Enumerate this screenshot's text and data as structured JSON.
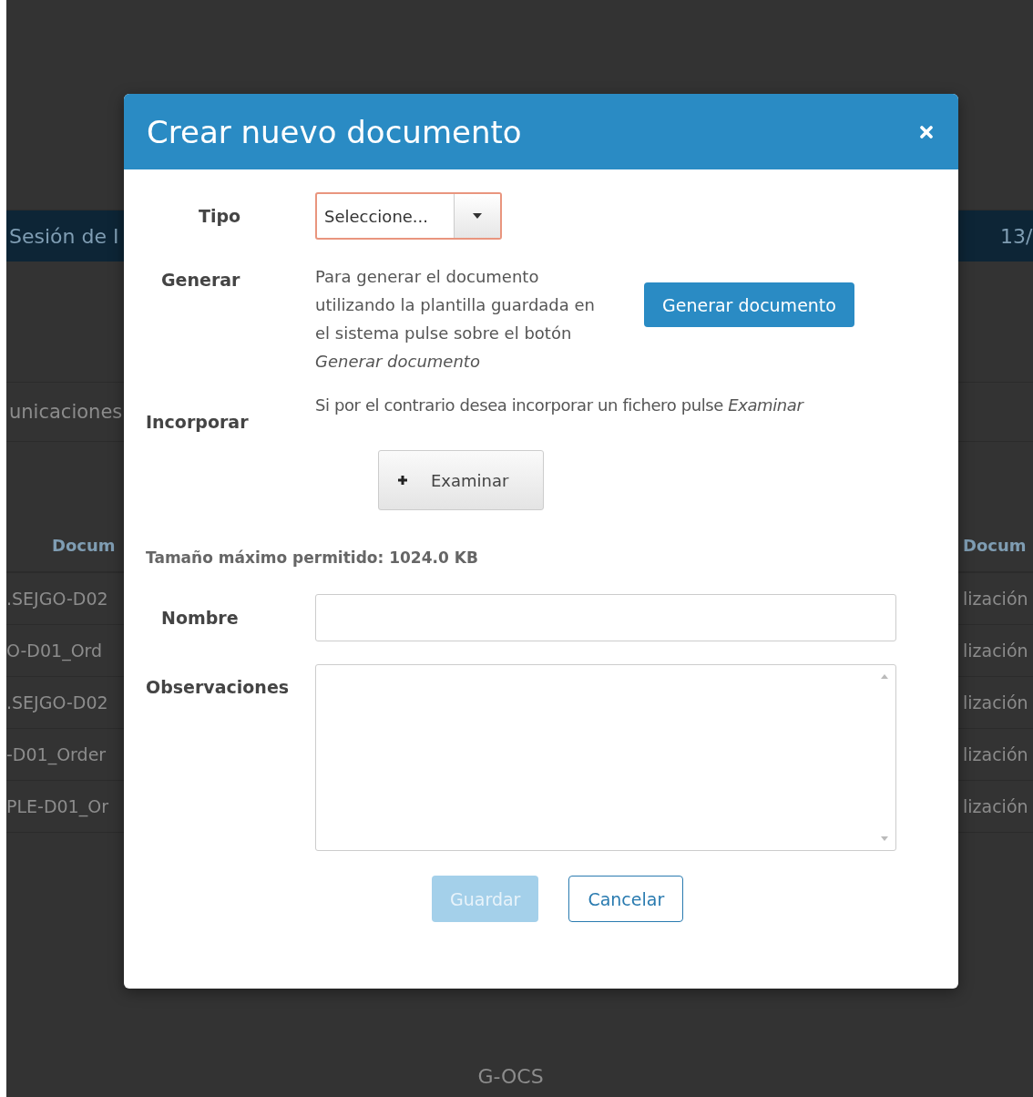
{
  "background": {
    "banner": {
      "left": "Sesión de I",
      "right": "13/"
    },
    "section": "unicaciones",
    "table": {
      "columns": [
        "Docum",
        "Docum"
      ],
      "rows": [
        {
          "column_1": ".SEJGO-D02",
          "column_2": "lización"
        },
        {
          "column_1": "O-D01_Ord",
          "column_2": "lización"
        },
        {
          "column_1": ".SEJGO-D02",
          "column_2": "lización"
        },
        {
          "column_1": "-D01_Order",
          "column_2": "lización"
        },
        {
          "column_1": "PLE-D01_Or",
          "column_2": "lización"
        }
      ]
    },
    "footer": "G-OCS"
  },
  "dialog": {
    "title": "Crear nuevo documento",
    "tipo": {
      "label": "Tipo",
      "placeholder": "Seleccione...",
      "invalid": true
    },
    "generar": {
      "label": "Generar",
      "text": "Para generar el documento utilizando la plantilla guardada en el sistema pulse sobre el botón *Generar documento*",
      "button": "Generar documento"
    },
    "incorporar": {
      "label": "Incorporar",
      "text": "Si por el contrario desea incorporar un fichero pulse *Examinar*",
      "button": "Examinar"
    },
    "max_size": "Tamaño máximo permitido: 1024.0 KB",
    "nombre": {
      "label": "Nombre"
    },
    "observaciones": {
      "label": "Observaciones"
    },
    "actions": [
      {
        "label": "Guardar",
        "kind": "primary",
        "disabled": true
      },
      {
        "label": "Cancelar",
        "kind": "outline",
        "disabled": false
      }
    ]
  }
}
